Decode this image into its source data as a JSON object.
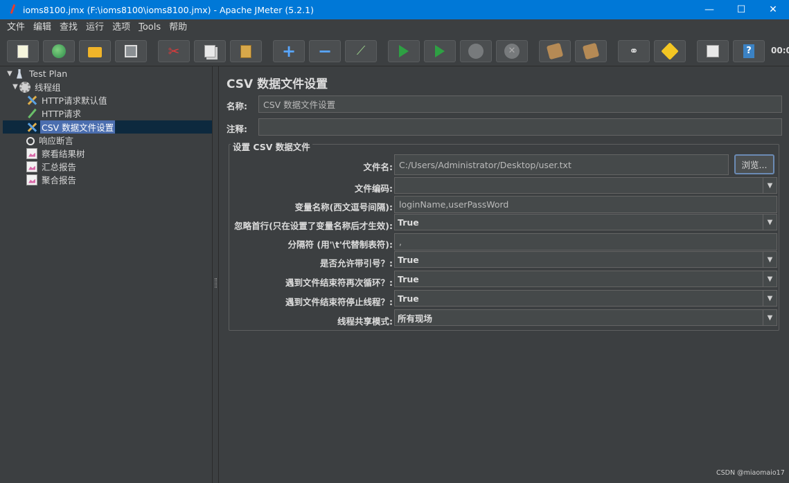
{
  "window": {
    "title": "ioms8100.jmx (F:\\ioms8100\\ioms8100.jmx) - Apache JMeter (5.2.1)",
    "minimize_glyph": "—",
    "maximize_glyph": "☐",
    "close_glyph": "✕"
  },
  "menu": [
    "文件",
    "编辑",
    "查找",
    "运行",
    "选项",
    "Tools",
    "帮助"
  ],
  "toolbar": {
    "icons": [
      "new-icon",
      "templates-icon",
      "open-icon",
      "save-icon",
      "cut-icon",
      "copy-icon",
      "paste-icon",
      "expand-icon",
      "collapse-icon",
      "toggle-icon",
      "start-icon",
      "start-no-timers-icon",
      "stop-icon",
      "shutdown-icon",
      "clear-icon",
      "clear-all-icon",
      "search-icon",
      "reset-search-icon",
      "function-helper-icon",
      "help-icon"
    ],
    "elapsed_time": "00:0"
  },
  "tree": {
    "items": [
      {
        "label": "Test Plan",
        "icon": "test-plan-icon"
      },
      {
        "label": "线程组",
        "icon": "thread-group-icon"
      },
      {
        "label": "HTTP请求默认值",
        "icon": "config-icon"
      },
      {
        "label": "HTTP请求",
        "icon": "sampler-icon"
      },
      {
        "label": "CSV 数据文件设置",
        "icon": "config-icon",
        "selected": true
      },
      {
        "label": "响应断言",
        "icon": "assertion-icon"
      },
      {
        "label": "察看结果树",
        "icon": "listener-icon"
      },
      {
        "label": "汇总报告",
        "icon": "listener-icon"
      },
      {
        "label": "聚合报告",
        "icon": "listener-icon"
      }
    ]
  },
  "panel": {
    "title": "CSV 数据文件设置",
    "name_label": "名称:",
    "name_value": "CSV 数据文件设置",
    "comment_label": "注释:",
    "comment_value": "",
    "group_title": "设置 CSV 数据文件",
    "filename_label": "文件名:",
    "filename_value": "C:/Users/Administrator/Desktop/user.txt",
    "browse_label": "浏览...",
    "encoding_label": "文件编码:",
    "encoding_value": "",
    "varnames_label": "变量名称(西文逗号间隔):",
    "varnames_value": "loginName,userPassWord",
    "ignore_first_label": "忽略首行(只在设置了变量名称后才生效):",
    "ignore_first_value": "True",
    "delimiter_label": "分隔符 (用'\\t'代替制表符):",
    "delimiter_value": ",",
    "quoted_label": "是否允许带引号？:",
    "quoted_value": "True",
    "recycle_label": "遇到文件结束符再次循环？:",
    "recycle_value": "True",
    "stop_thread_label": "遇到文件结束符停止线程？:",
    "stop_thread_value": "True",
    "share_mode_label": "线程共享模式:",
    "share_mode_value": "所有现场"
  },
  "watermark": "CSDN @miaomaio17"
}
